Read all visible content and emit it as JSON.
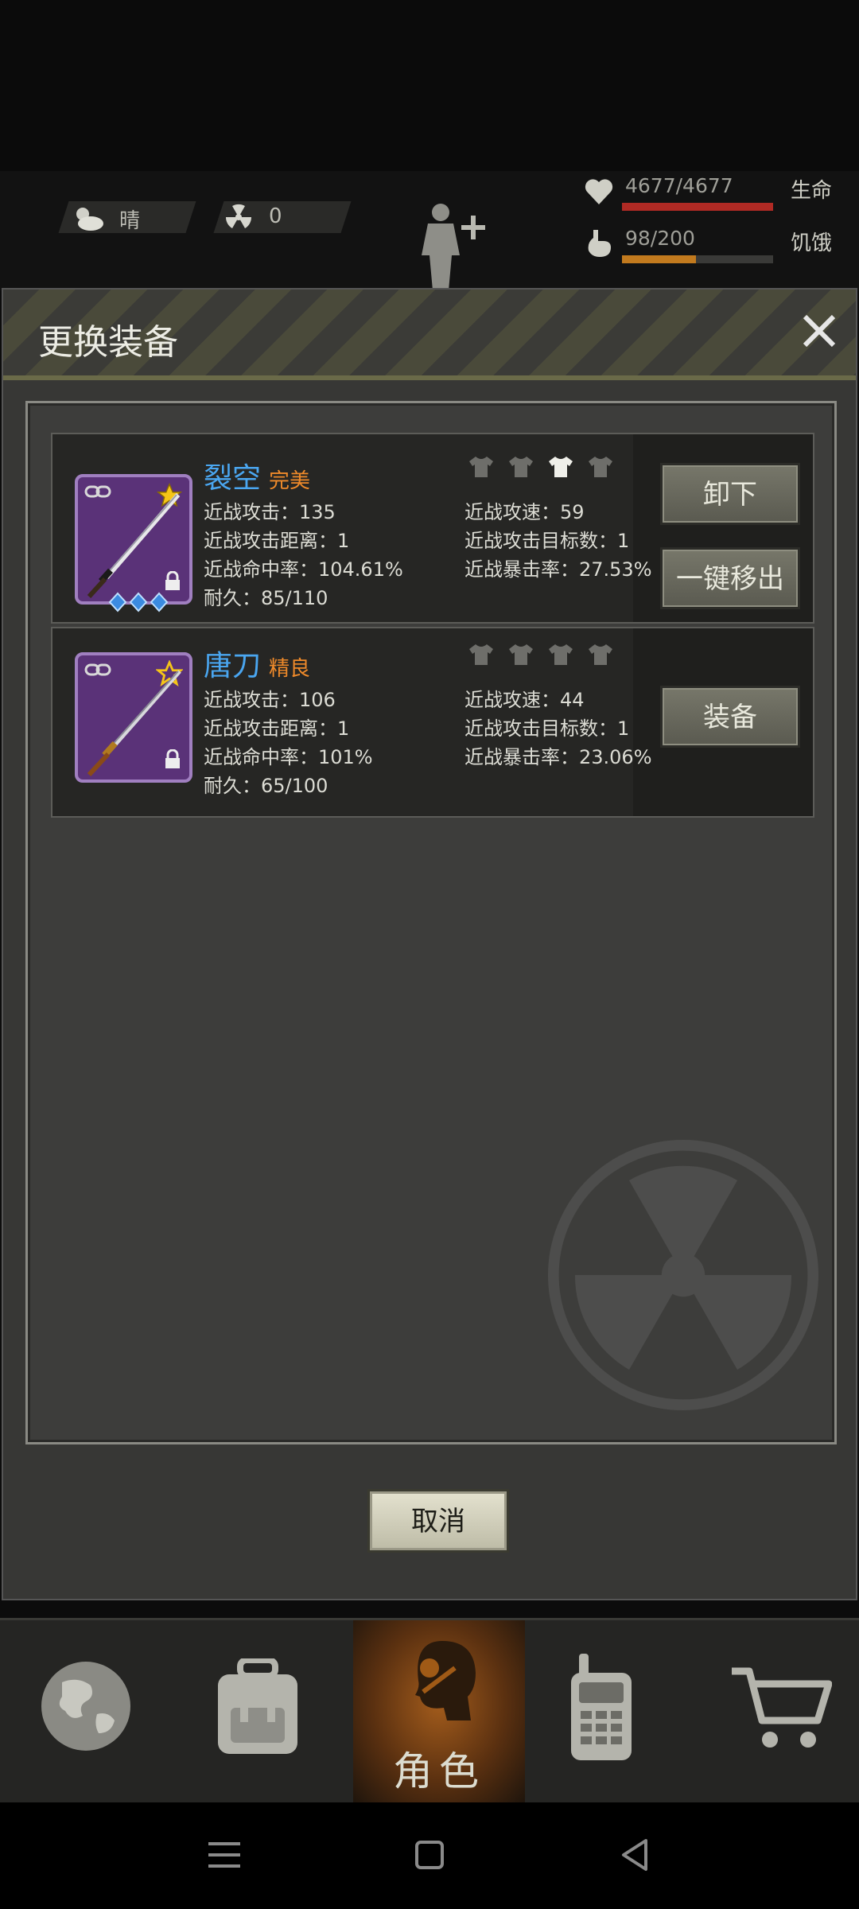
{
  "status": {
    "weather": "晴",
    "radiation": "0",
    "life": {
      "value": "4677/4677",
      "label": "生命",
      "fraction": 1.0
    },
    "hunger": {
      "value": "98/200",
      "label": "饥饿",
      "fraction": 0.49
    }
  },
  "dialog": {
    "title": "更换装备",
    "cancel_label": "取消",
    "items": [
      {
        "name": "裂空",
        "quality": "完美",
        "stats": {
          "melee_attack": "近战攻击：135",
          "melee_range": "近战攻击距离：1",
          "melee_hit": "近战命中率：104.61%",
          "durability": "耐久：85/110",
          "melee_speed": "近战攻速：59",
          "melee_targets": "近战攻击目标数：1",
          "melee_crit": "近战暴击率：27.53%"
        },
        "buttons": [
          "卸下",
          "一键移出"
        ]
      },
      {
        "name": "唐刀",
        "quality": "精良",
        "stats": {
          "melee_attack": "近战攻击：106",
          "melee_range": "近战攻击距离：1",
          "melee_hit": "近战命中率：101%",
          "durability": "耐久：65/100",
          "melee_speed": "近战攻速：44",
          "melee_targets": "近战攻击目标数：1",
          "melee_crit": "近战暴击率：23.06%"
        },
        "buttons": [
          "装备"
        ]
      }
    ]
  },
  "nav": {
    "items": [
      "world-icon",
      "backpack-icon",
      "character-icon",
      "radio-icon",
      "cart-icon"
    ],
    "active_label": "角色"
  },
  "colors": {
    "quality_orange": "#ef8a2a",
    "name_blue": "#4aa6f0",
    "life_red": "#b02a24",
    "hunger_orange": "#c27a1e"
  }
}
